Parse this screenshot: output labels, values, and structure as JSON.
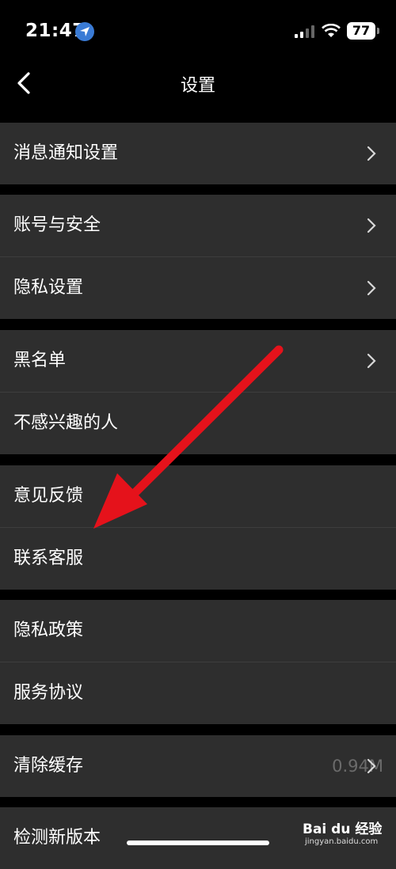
{
  "status_bar": {
    "time": "21:47",
    "battery": "77"
  },
  "nav": {
    "title": "设置"
  },
  "groups": [
    {
      "items": [
        {
          "label": "消息通知设置",
          "chevron": true
        }
      ]
    },
    {
      "items": [
        {
          "label": "账号与安全",
          "chevron": true
        },
        {
          "label": "隐私设置",
          "chevron": true
        }
      ]
    },
    {
      "items": [
        {
          "label": "黑名单",
          "chevron": true
        },
        {
          "label": "不感兴趣的人",
          "chevron": false
        }
      ]
    },
    {
      "items": [
        {
          "label": "意见反馈",
          "chevron": false
        },
        {
          "label": "联系客服",
          "chevron": false
        }
      ]
    },
    {
      "items": [
        {
          "label": "隐私政策",
          "chevron": false
        },
        {
          "label": "服务协议",
          "chevron": false
        }
      ]
    },
    {
      "items": [
        {
          "label": "清除缓存",
          "value": "0.94M",
          "chevron": true
        }
      ]
    },
    {
      "items": [
        {
          "label": "检测新版本",
          "chevron": false
        }
      ]
    }
  ],
  "watermark": {
    "brand": "Bai du 经验",
    "url": "jingyan.baidu.com"
  },
  "colors": {
    "background": "#000000",
    "row": "#2e2e2e",
    "annotation_arrow": "#e5121b"
  }
}
